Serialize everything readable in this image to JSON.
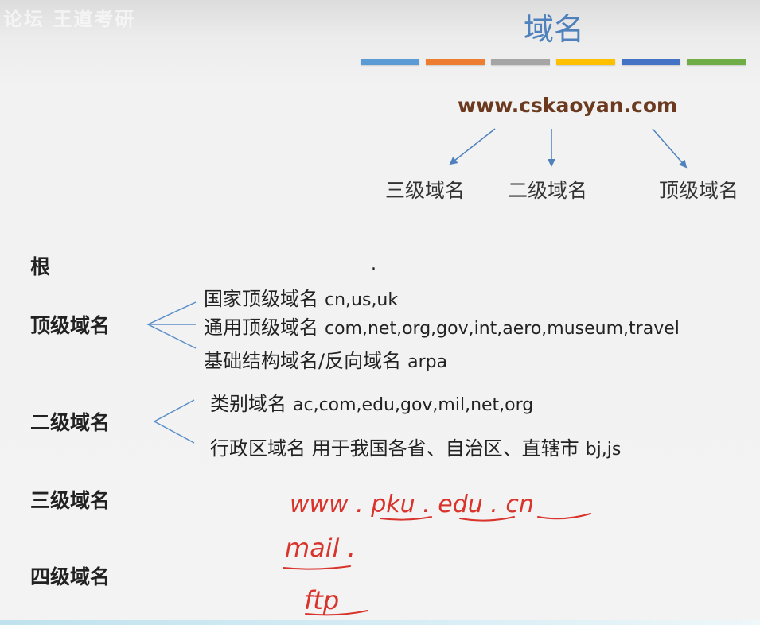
{
  "watermark": "论坛 王道考研",
  "title": "域名",
  "color_bars": [
    "#5b9bd5",
    "#ed7d31",
    "#a5a5a5",
    "#ffc000",
    "#4472c4",
    "#70ad47"
  ],
  "example_domain": "www.cskaoyan.com",
  "example_parts": [
    "三级域名",
    "二级域名",
    "顶级域名"
  ],
  "root": {
    "label": "根",
    "symbol": "."
  },
  "top_level": {
    "label": "顶级域名",
    "items": [
      {
        "name": "国家顶级域名",
        "examples": "cn,us,uk"
      },
      {
        "name": "通用顶级域名",
        "examples": "com,net,org,gov,int,aero,museum,travel"
      },
      {
        "name": "基础结构域名/反向域名",
        "examples": "arpa"
      }
    ]
  },
  "second_level": {
    "label": "二级域名",
    "items": [
      {
        "name": "类别域名",
        "examples": "ac,com,edu,gov,mil,net,org"
      },
      {
        "name": "行政区域名  用于我国各省、自治区、直辖市",
        "examples": "bj,js"
      }
    ]
  },
  "third_level": {
    "label": "三级域名"
  },
  "fourth_level": {
    "label": "四级域名"
  },
  "handwriting": {
    "color": "#d9342b",
    "lines": [
      "www . pku . edu . cn",
      "mail .",
      "ftp"
    ]
  }
}
